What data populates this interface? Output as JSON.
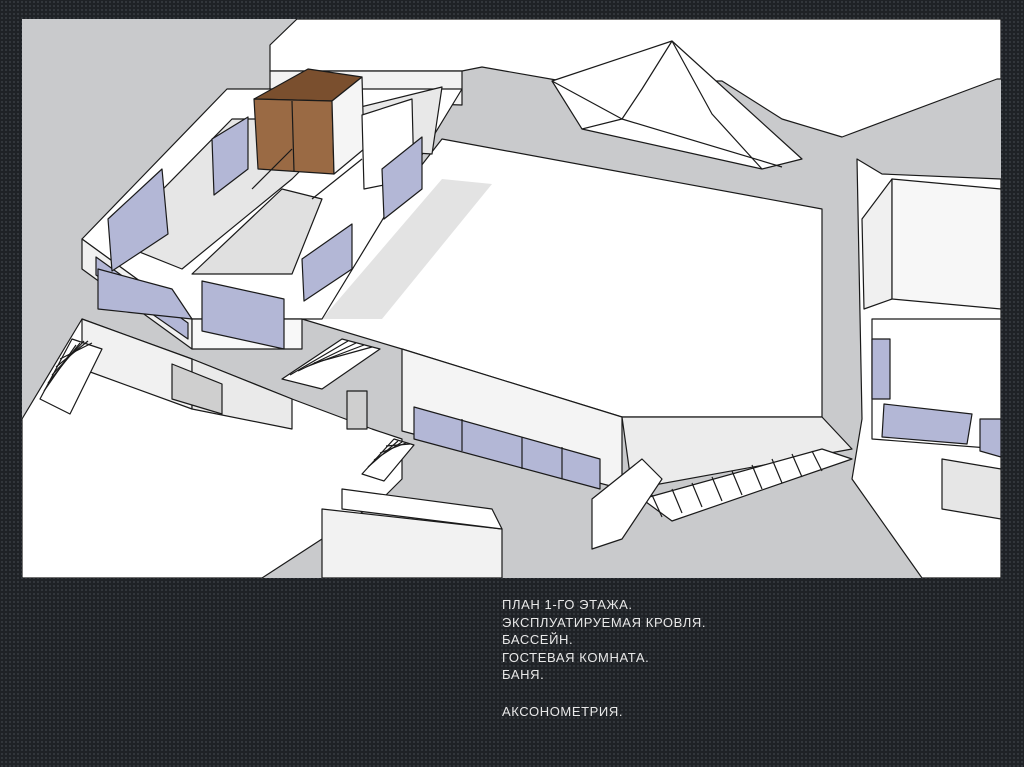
{
  "slide": {
    "caption_lines": [
      "ПЛАН 1-ГО ЭТАЖА.",
      "ЭКСПЛУАТИРУЕМАЯ КРОВЛЯ.",
      "БАССЕЙН.",
      "ГОСТЕВАЯ КОМНАТА.",
      "БАНЯ."
    ],
    "caption_sub": "АКСОНОМЕТРИЯ."
  },
  "colors": {
    "background": "#1f2226",
    "ground": "#c9cacc",
    "wall": "#ffffff",
    "shadow": "#cdcdcd",
    "glass": "#b3b7d6",
    "wood": "#9a6a44"
  }
}
